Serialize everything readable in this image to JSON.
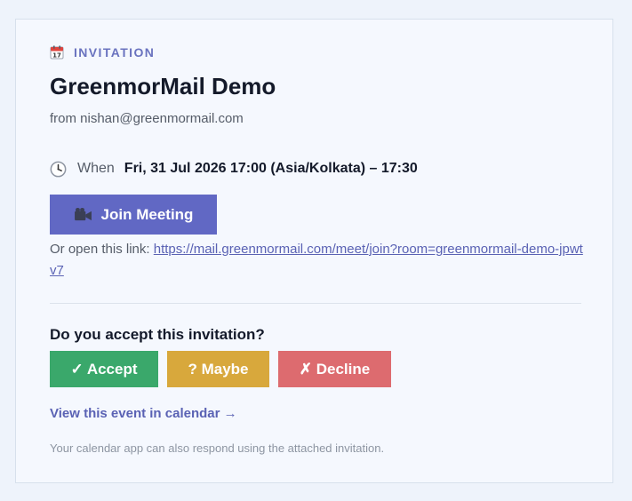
{
  "invitation": {
    "eyebrow_icon": "calendar-icon",
    "eyebrow_label": "INVITATION",
    "title": "GreenmorMail Demo",
    "from_line": "from nishan@greenmormail.com",
    "when_icon": "clock-icon",
    "when_label": "When",
    "when_value": "Fri, 31 Jul 2026 17:00 (Asia/Kolkata) – 17:30"
  },
  "join": {
    "icon": "video-camera-icon",
    "label": "Join Meeting",
    "link_prefix": "Or open this link:",
    "link_text": "https://mail.greenmormail.com/meet/join?room=greenmormail-demo-jpwtv7"
  },
  "rsvp": {
    "question": "Do you accept this invitation?",
    "accept_label": "✓ Accept",
    "maybe_label": "? Maybe",
    "decline_label": "✗ Decline"
  },
  "calendar_link_label": "View this event in calendar →",
  "footnote": "Your calendar app can also respond using the attached invitation.",
  "colors": {
    "accent": "#6168c4",
    "accept": "#3aa86b",
    "maybe": "#d8a83c",
    "decline": "#dd6b6f"
  }
}
